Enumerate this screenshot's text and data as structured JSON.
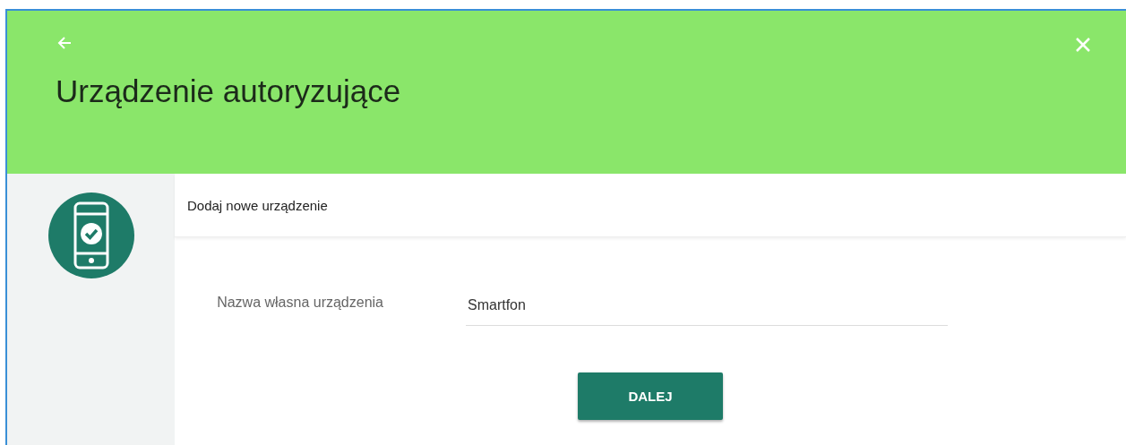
{
  "header": {
    "title": "Urządzenie autoryzujące"
  },
  "section": {
    "title": "Dodaj nowe urządzenie"
  },
  "form": {
    "fields": [
      {
        "label": "Nazwa własna urządzenia",
        "value": "Smartfon"
      }
    ]
  },
  "buttons": [
    {
      "label": "DALEJ"
    }
  ]
}
